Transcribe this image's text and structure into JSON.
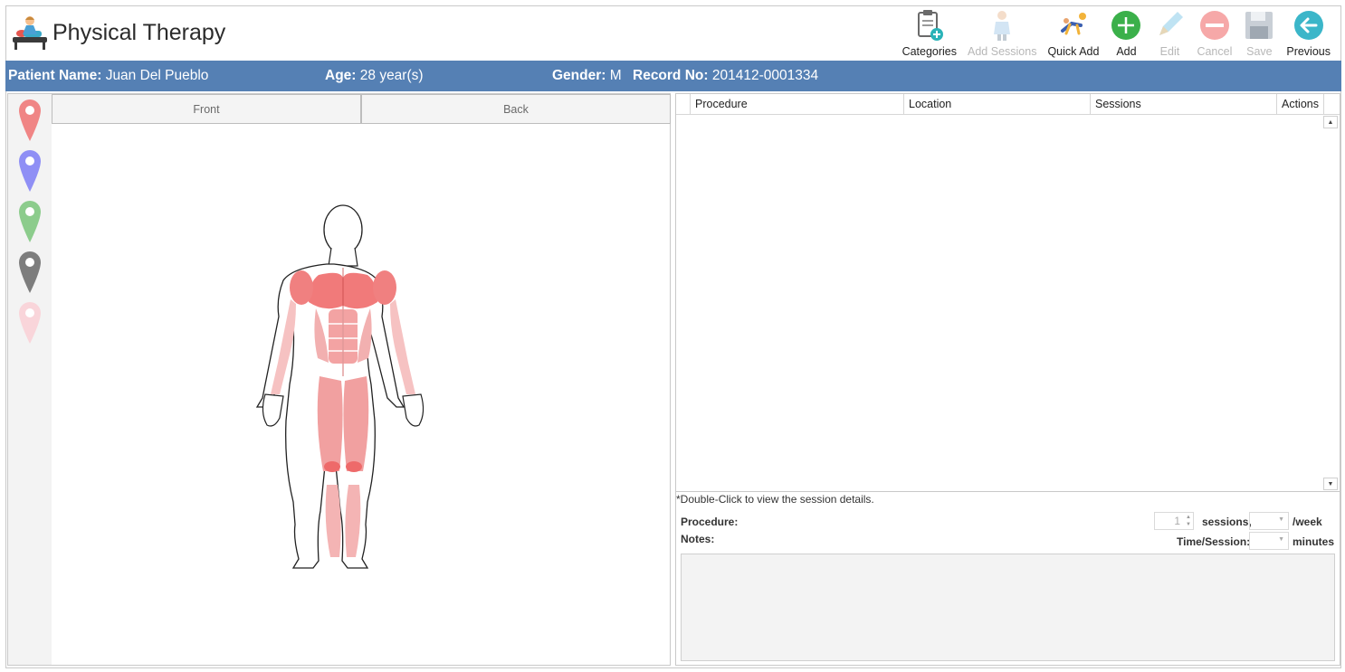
{
  "app": {
    "title": "Physical Therapy"
  },
  "toolbar": {
    "categories": "Categories",
    "add_sessions": "Add Sessions",
    "quick_add": "Quick Add",
    "add": "Add",
    "edit": "Edit",
    "cancel": "Cancel",
    "save": "Save",
    "previous": "Previous"
  },
  "patient": {
    "name_label": "Patient Name:",
    "name": "Juan Del Pueblo",
    "age_label": "Age:",
    "age": "28 year(s)",
    "gender_label": "Gender:",
    "gender": "M",
    "record_label": "Record No:",
    "record": "201412-0001334"
  },
  "body_view": {
    "tabs": [
      "Front",
      "Back"
    ]
  },
  "pins": [
    {
      "color": "#f08585",
      "icon": "red-pin-icon"
    },
    {
      "color": "#8f8ff5",
      "icon": "blue-pin-icon"
    },
    {
      "color": "#8ccc8c",
      "icon": "green-pin-icon"
    },
    {
      "color": "#7d7d7d",
      "icon": "gray-pin-icon"
    },
    {
      "color": "#f9d5da",
      "icon": "pink-pin-icon"
    }
  ],
  "grid": {
    "columns": [
      "Procedure",
      "Location",
      "Sessions",
      "Actions"
    ],
    "rows": []
  },
  "hint": "*Double-Click to view the session details.",
  "form": {
    "procedure_label": "Procedure:",
    "notes_label": "Notes:",
    "sessions_value": "1",
    "sessions_label": "sessions,",
    "per_week_label": "/week",
    "time_session_label": "Time/Session:",
    "minutes_label": "minutes"
  },
  "colors": {
    "patient_bar": "#5580b4",
    "add": "#3bb04a",
    "previous": "#3bb6c9"
  }
}
